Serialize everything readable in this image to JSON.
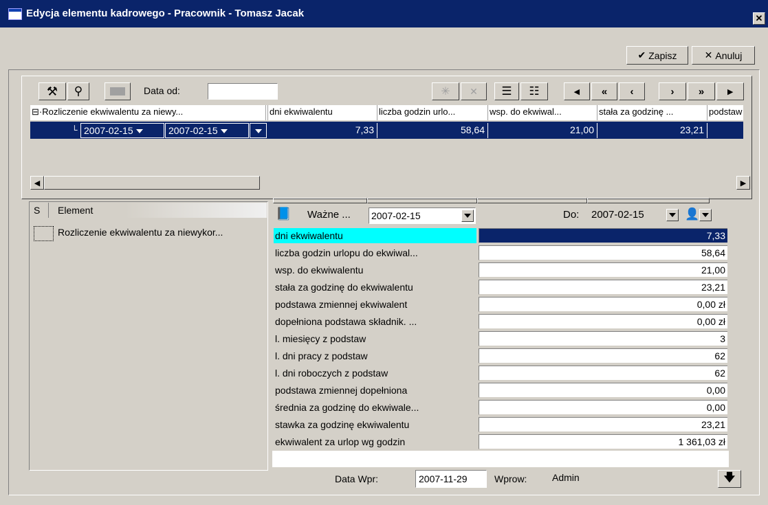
{
  "window": {
    "title": "Edycja elementu kadrowego - Pracownik - Tomasz Jacak",
    "close_glyph": "✕"
  },
  "actions": {
    "save_label": "Zapisz",
    "save_glyph": "✔",
    "cancel_label": "Anuluj",
    "cancel_glyph": "✕"
  },
  "toolbar": {
    "date_from_label": "Data od:",
    "date_from_value": ""
  },
  "grid": {
    "columns": [
      "Rozliczenie ekwiwalentu za niewy...",
      "dni ekwiwalentu",
      "liczba godzin urlo...",
      "wsp. do ekwiwal...",
      "stała za godzinę ...",
      "podstaw"
    ],
    "row": {
      "date_1": "2007-02-15",
      "date_2": "2007-02-15",
      "values": [
        "7,33",
        "58,64",
        "21,00",
        "23,21"
      ]
    }
  },
  "element_list": {
    "col_s": "S",
    "col_element": "Element",
    "items": [
      "Rozliczenie ekwiwalentu za niewykor..."
    ]
  },
  "detail": {
    "valid_label": "Ważne ...",
    "valid_date": "2007-02-15",
    "to_label": "Do:",
    "to_date": "2007-02-15",
    "rows": [
      {
        "label": "dni ekwiwalentu",
        "value": "7,33"
      },
      {
        "label": "liczba godzin urlopu do ekwiwal...",
        "value": "58,64"
      },
      {
        "label": "wsp. do ekwiwalentu",
        "value": "21,00"
      },
      {
        "label": "stała za godzinę do ekwiwalentu",
        "value": "23,21"
      },
      {
        "label": "podstawa zmiennej ekwiwalent",
        "value": "0,00 zł"
      },
      {
        "label": "dopełniona podstawa składnik. ...",
        "value": "0,00 zł"
      },
      {
        "label": "l. miesięcy z podstaw",
        "value": "3"
      },
      {
        "label": "l. dni pracy z podstaw",
        "value": "62"
      },
      {
        "label": "l. dni roboczych z podstaw",
        "value": "62"
      },
      {
        "label": "podstawa zmiennej dopełniona",
        "value": "0,00"
      },
      {
        "label": "średnia za godzinę do ekwiwale...",
        "value": "0,00"
      },
      {
        "label": "stawka za godzinę ekwiwalentu",
        "value": "23,21"
      },
      {
        "label": "ekwiwalent za urlop wg godzin",
        "value": "1 361,03 zł"
      }
    ]
  },
  "footer": {
    "entry_date_label": "Data Wpr:",
    "entry_date_value": "2007-11-29",
    "entered_by_label": "Wprow:",
    "entered_by_value": "Admin"
  },
  "colors": {
    "titlebar": "#0a246a",
    "selection": "#0a246a",
    "highlight": "#00ffff",
    "face": "#d4d0c8"
  }
}
